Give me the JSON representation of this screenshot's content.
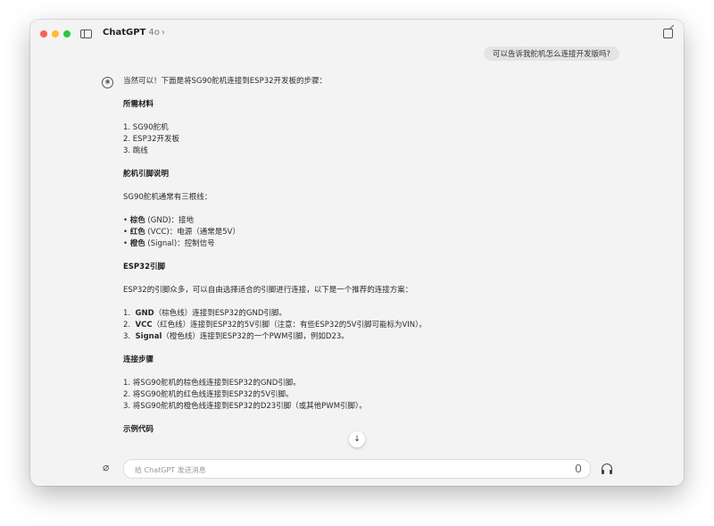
{
  "app": {
    "title": "ChatGPT",
    "model": "4o",
    "chevron": "›"
  },
  "user_message": "可以告诉我舵机怎么连接开发版吗?",
  "assistant": {
    "avatar_icon": "openai-logo-icon",
    "intro": "当然可以！下面是将SG90舵机连接到ESP32开发板的步骤：",
    "materials": {
      "heading": "所需材料",
      "items": [
        "1.  SG90舵机",
        "2.  ESP32开发板",
        "3.  跳线"
      ]
    },
    "servo_pins": {
      "heading": "舵机引脚说明",
      "intro": "SG90舵机通常有三根线：",
      "items": [
        {
          "name": "棕色",
          "desc": " (GND)：接地"
        },
        {
          "name": "红色",
          "desc": " (VCC)：电源（通常是5V）"
        },
        {
          "name": "橙色",
          "desc": " (Signal)：控制信号"
        }
      ]
    },
    "esp32_pins": {
      "heading": "ESP32引脚",
      "intro": "ESP32的引脚众多，可以自由选择适合的引脚进行连接，以下是一个推荐的连接方案：",
      "items": [
        {
          "num": "1.",
          "name": "GND",
          "desc": "（棕色线）连接到ESP32的GND引脚。"
        },
        {
          "num": "2.",
          "name": "VCC",
          "desc": "（红色线）连接到ESP32的5V引脚（注意：有些ESP32的5V引脚可能标为VIN）。"
        },
        {
          "num": "3.",
          "name": "Signal",
          "desc": "（橙色线）连接到ESP32的一个PWM引脚，例如D23。"
        }
      ]
    },
    "steps": {
      "heading": "连接步骤",
      "items": [
        "1.  将SG90舵机的棕色线连接到ESP32的GND引脚。",
        "2.  将SG90舵机的红色线连接到ESP32的5V引脚。",
        "3.  将SG90舵机的橙色线连接到ESP32的D23引脚（或其他PWM引脚）。"
      ]
    },
    "code_heading": "示例代码"
  },
  "scroll_down_glyph": "↓",
  "composer": {
    "placeholder": "给 ChatGPT 发送消息"
  },
  "colors": {
    "window_bg": "#f3f3f3",
    "bubble_bg": "#e4e4e4",
    "close": "#fe5f57",
    "minimize": "#febc2e",
    "zoom": "#28c840"
  }
}
